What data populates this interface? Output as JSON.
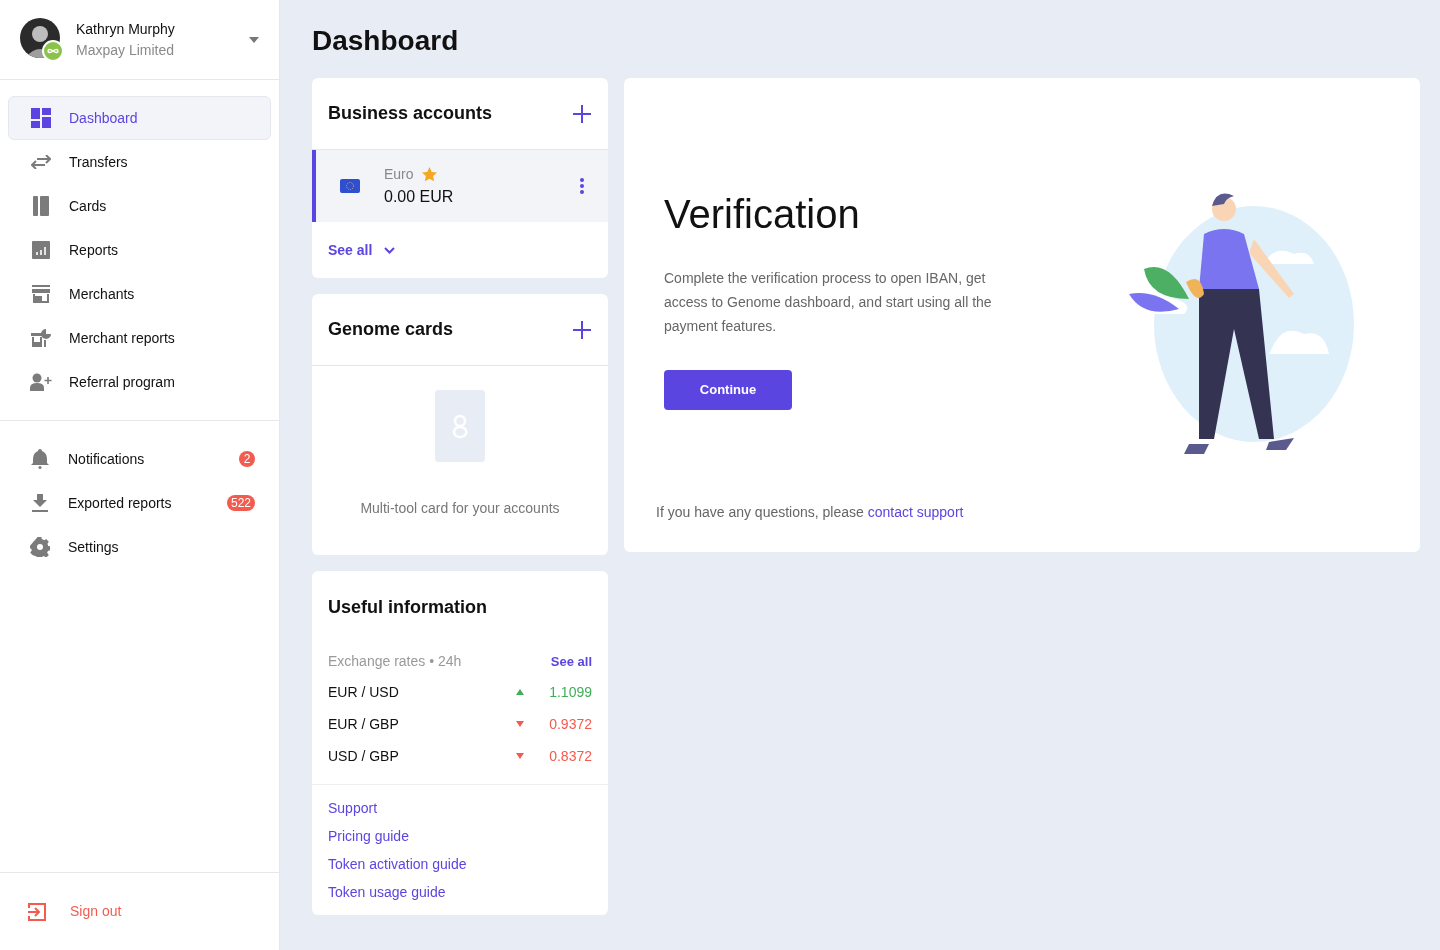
{
  "user": {
    "name": "Kathryn Murphy",
    "company": "Maxpay Limited"
  },
  "nav": [
    {
      "label": "Dashboard",
      "selected": true
    },
    {
      "label": "Transfers",
      "selected": false
    },
    {
      "label": "Cards",
      "selected": false
    },
    {
      "label": "Reports",
      "selected": false
    },
    {
      "label": "Merchants",
      "selected": false
    },
    {
      "label": "Merchant reports",
      "selected": false
    },
    {
      "label": "Referral program",
      "selected": false
    }
  ],
  "secondary_nav": [
    {
      "label": "Notifications",
      "badge": "2"
    },
    {
      "label": "Exported reports",
      "badge": "522"
    },
    {
      "label": "Settings"
    }
  ],
  "sign_out": "Sign out",
  "page_title": "Dashboard",
  "business_accounts": {
    "title": "Business accounts",
    "accounts": [
      {
        "name": "Euro",
        "favorite": true,
        "balance": "0.00 EUR",
        "selected": true
      }
    ],
    "see_all": "See all"
  },
  "genome_cards": {
    "title": "Genome cards",
    "empty_text": "Multi-tool card for your accounts"
  },
  "useful_information": {
    "title": "Useful information",
    "rates_label": "Exchange rates • 24h",
    "see_all": "See all",
    "rates": [
      {
        "pair": "EUR / USD",
        "rising": true,
        "value": "1.1099"
      },
      {
        "pair": "EUR / GBP",
        "rising": false,
        "value": "0.9372"
      },
      {
        "pair": "USD / GBP",
        "rising": false,
        "value": "0.8372"
      }
    ],
    "links": [
      "Support",
      "Pricing guide",
      "Token activation guide",
      "Token usage guide"
    ]
  },
  "verification": {
    "title": "Verification",
    "text": "Complete the verification process to open IBAN, get access to Genome dashboard, and start using all the payment features.",
    "button": "Continue",
    "footer": "If you have any questions, please",
    "footer_link": "contact support"
  }
}
